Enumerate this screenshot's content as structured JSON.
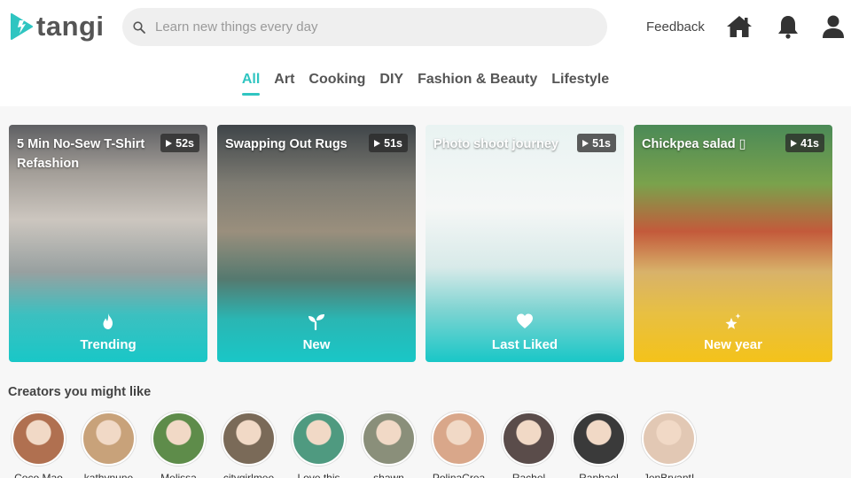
{
  "header": {
    "brand": "tangi",
    "search_placeholder": "Learn new things every day",
    "feedback_label": "Feedback",
    "brand_color": "#2fc5c1"
  },
  "tabs": [
    {
      "label": "All",
      "active": true
    },
    {
      "label": "Art"
    },
    {
      "label": "Cooking"
    },
    {
      "label": "DIY"
    },
    {
      "label": "Fashion & Beauty"
    },
    {
      "label": "Lifestyle"
    }
  ],
  "cards": [
    {
      "title": "5 Min No-Sew T-Shirt Refashion",
      "duration": "52s",
      "label": "Trending",
      "icon": "flame-icon"
    },
    {
      "title": "Swapping Out Rugs",
      "duration": "51s",
      "label": "New",
      "icon": "sprout-icon"
    },
    {
      "title": "Photo shoot journey",
      "duration": "51s",
      "label": "Last Liked",
      "icon": "heart-icon"
    },
    {
      "title": "Chickpea salad ▯",
      "duration": "41s",
      "label": "New year",
      "icon": "sparkle-star-icon"
    }
  ],
  "creators_section": {
    "title": "Creators you might like",
    "creators": [
      {
        "name": "Coco Mao",
        "color": "#b07050"
      },
      {
        "name": "kathynune",
        "color": "#c8a27a"
      },
      {
        "name": "Melissa",
        "color": "#5e8c4a"
      },
      {
        "name": "citygirlmee",
        "color": "#7a6a58"
      },
      {
        "name": "Love this",
        "color": "#4f9a80"
      },
      {
        "name": "shawn",
        "color": "#8a8f7a"
      },
      {
        "name": "PolinaCrea",
        "color": "#d9a78a"
      },
      {
        "name": "Rachel",
        "color": "#5a4c4a"
      },
      {
        "name": "Raphael",
        "color": "#3a3a3a"
      },
      {
        "name": "JenBryantI",
        "color": "#e2c8b4"
      }
    ]
  }
}
